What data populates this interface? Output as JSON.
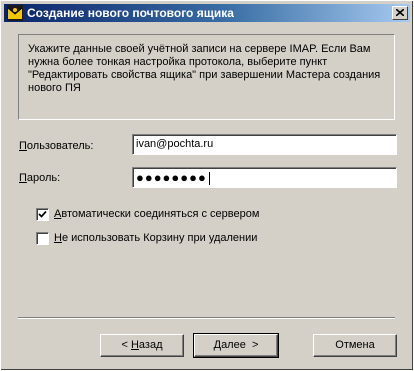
{
  "window": {
    "title": "Создание нового почтового ящика",
    "icon": "mail-app-icon",
    "close_icon": "close-icon"
  },
  "info": {
    "text": "Укажите данные своей учётной записи на сервере IMAP. Если Вам нужна более тонкая настройка протокола, выберите пункт \"Редактировать свойства ящика\" при завершении Мастера создания нового ПЯ"
  },
  "form": {
    "user_label_accel": "П",
    "user_label_rest": "ользователь:",
    "user_value": "ivan@pochta.ru",
    "password_label_accel": "П",
    "password_label_rest": "ароль:",
    "password_value": "●●●●●●●●"
  },
  "options": {
    "auto_connect": {
      "accel": "А",
      "rest": "втоматически соединяться с сервером",
      "checked": true
    },
    "no_trash": {
      "accel": "Н",
      "rest": "е использовать Корзину при удалении",
      "checked": false
    }
  },
  "buttons": {
    "back_prefix": "< ",
    "back_accel": "Н",
    "back_rest": "азад",
    "next_accel": "Д",
    "next_rest": "алее  >",
    "cancel": "Отмена"
  }
}
